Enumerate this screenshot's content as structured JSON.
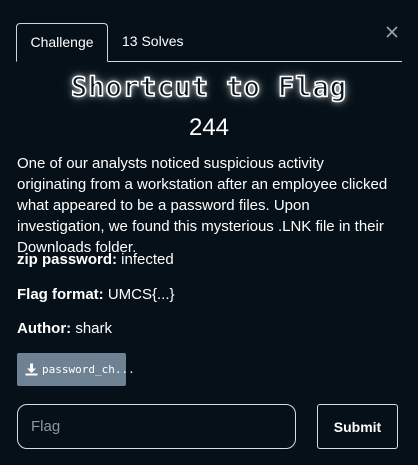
{
  "tabs": {
    "challenge": "Challenge",
    "solves": "13 Solves"
  },
  "challenge": {
    "name": "Shortcut to Flag",
    "value": "244",
    "description": "One of our analysts noticed suspicious activity originating from a workstation after an employee clicked what appeared to be a password files. Upon investigation, we found this mysterious .LNK file in their Downloads folder.",
    "zip_password_label": "zip password:",
    "zip_password_value": " infected",
    "flag_format_label": "Flag format:",
    "flag_format_value": " UMCS{...}",
    "author_label": "Author:",
    "author_value": " shark"
  },
  "file": {
    "label": "password_ch...",
    "icon": "download-icon"
  },
  "form": {
    "flag_placeholder": "Flag",
    "flag_value": "",
    "submit_label": "Submit"
  },
  "colors": {
    "background": "#051018",
    "file_button": "#6f8294",
    "border": "#cfd6dc"
  }
}
